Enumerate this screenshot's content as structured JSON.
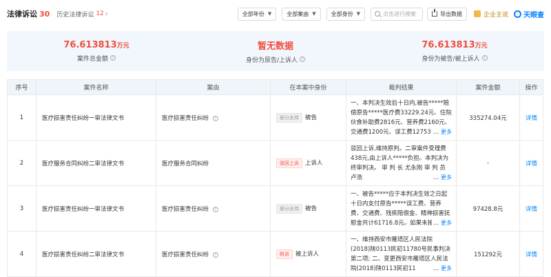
{
  "header": {
    "title": "法律诉讼",
    "title_count": "30",
    "history_label": "历史法律诉讼",
    "history_count": "12",
    "filters": [
      "全部年份",
      "全部案由",
      "全部身份"
    ],
    "search_placeholder": "点击进行搜索",
    "export_label": "导出数据",
    "vip_label": "企业主说",
    "brand_label": "天眼查"
  },
  "summary": [
    {
      "value": "76.613813",
      "unit": "万元",
      "label": "案件总金额"
    },
    {
      "value": "暂无数据",
      "unit": "",
      "label": "身份为原告/上诉人"
    },
    {
      "value": "76.613813",
      "unit": "万元",
      "label": "身份为被告/被上诉人"
    }
  ],
  "table": {
    "columns": [
      "序号",
      "案件名称",
      "案由",
      "在本案中身份",
      "裁判结果",
      "案件金额",
      "操作"
    ],
    "rows": [
      {
        "index": "1",
        "name": "医疗损害责任纠纷一审法律文书",
        "cause": "医疗损害责任纠纷",
        "tag": "部分支持",
        "tag_type": "support",
        "role": "被告",
        "result": "一、本判决生效后十日内,被告*****赔偿原告*****医疗费33229.24元、住院伙食补助费2816元、营养费2160元、交通费1200元、误工费12753",
        "amount": "335274.04元",
        "action": "详情"
      },
      {
        "index": "2",
        "name": "医疗服务合同纠纷二审法律文书",
        "cause": "医疗服务合同纠纷",
        "tag": "驳回上诉",
        "tag_type": "reject",
        "role": "上诉人",
        "result": "驳回上诉,维持原判。二审案件受理费438元,由上诉人*****负担。本判决为终审判决。 审 判 长 尤永刚 审 判 员 卢浩",
        "amount": "-",
        "action": "详情"
      },
      {
        "index": "3",
        "name": "医疗损害责任纠纷一审法律文书",
        "cause": "医疗损害责任纠纷",
        "tag": "部分支持",
        "tag_type": "support",
        "role": "被告",
        "result": "一、被告*****应于本判决生效之日起十日内支付原告*****误工费、营养费、交通费、残疾赔偿金、精神损害抚慰金共计61716.8元。如果未按照",
        "amount": "97428.8元",
        "action": "详情"
      },
      {
        "index": "4",
        "name": "医疗损害责任纠纷二审法律文书",
        "cause": "医疗损害责任纠纷",
        "tag": "败诉",
        "tag_type": "lose",
        "role": "被上诉人",
        "result": "一、维持西安市雁塔区人民法院(2018)陕0113民初11780号民事判决第二项; 二、变更西安市雁塔区人民法院(2018)陕0113民初11",
        "amount": "151292元",
        "action": "详情"
      }
    ],
    "more_label": "更多"
  }
}
